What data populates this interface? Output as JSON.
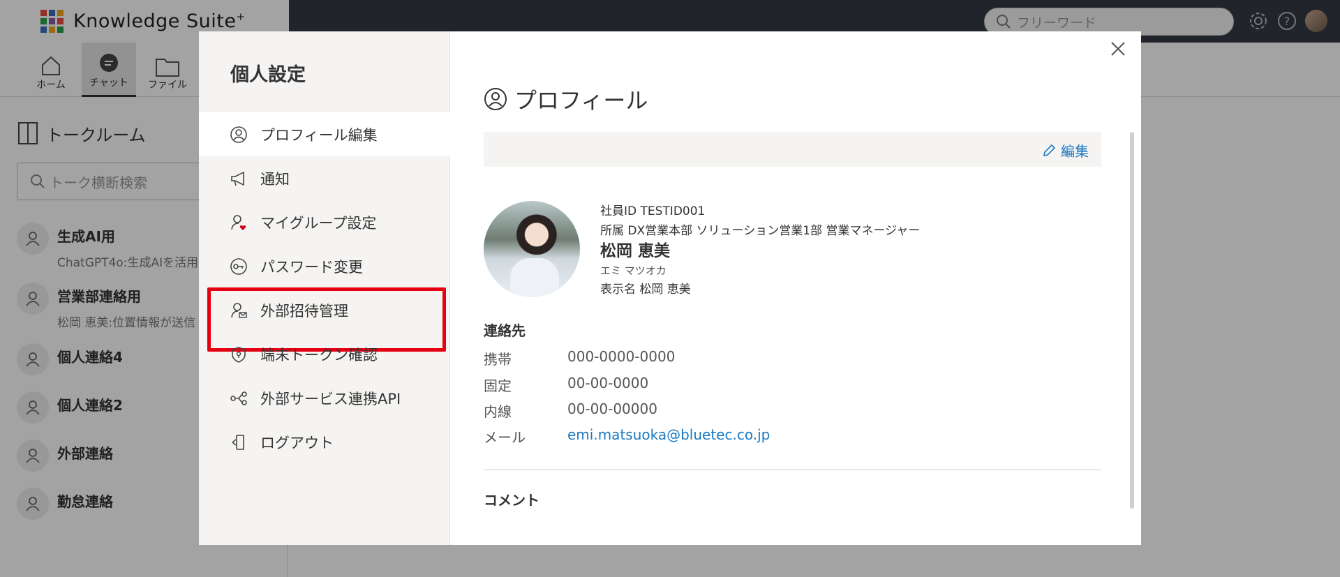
{
  "app": {
    "logo_text": "Knowledge Suite",
    "logo_sup": "+",
    "search_placeholder": "フリーワード"
  },
  "nav": [
    {
      "label": "ホーム",
      "icon": "home-icon"
    },
    {
      "label": "チャット",
      "icon": "chat-icon",
      "active": true
    },
    {
      "label": "ファイル",
      "icon": "folder-icon"
    }
  ],
  "talkroom": {
    "header": "トークルーム",
    "search_placeholder": "トーク横断検索",
    "rooms": [
      {
        "name": "生成AI用",
        "sub": "ChatGPT4o:生成AIを活用"
      },
      {
        "name": "営業部連絡用",
        "sub": "松岡 恵美:位置情報が送信"
      },
      {
        "name": "個人連絡4",
        "sub": ""
      },
      {
        "name": "個人連絡2",
        "sub": ""
      },
      {
        "name": "外部連絡",
        "sub": ""
      },
      {
        "name": "勤怠連絡",
        "sub": ""
      }
    ]
  },
  "modal": {
    "title": "個人設定",
    "menu": [
      {
        "label": "プロフィール編集",
        "icon": "user-circle-icon",
        "active": true
      },
      {
        "label": "通知",
        "icon": "megaphone-icon"
      },
      {
        "label": "マイグループ設定",
        "icon": "user-heart-icon"
      },
      {
        "label": "パスワード変更",
        "icon": "key-icon"
      },
      {
        "label": "外部招待管理",
        "icon": "user-mail-icon",
        "highlight": true
      },
      {
        "label": "端末トークン確認",
        "icon": "shield-icon"
      },
      {
        "label": "外部サービス連携API",
        "icon": "api-link-icon"
      },
      {
        "label": "ログアウト",
        "icon": "logout-icon"
      }
    ]
  },
  "profile": {
    "section_title": "プロフィール",
    "edit_label": "編集",
    "employee_id": "社員ID TESTID001",
    "affiliation": "所属 DX営業本部 ソリューション営業1部 営業マネージャー",
    "name": "松岡 恵美",
    "kana": "エミ マツオカ",
    "display_name": "表示名 松岡 恵美",
    "contact_title": "連絡先",
    "contacts": [
      {
        "key": "携帯",
        "value": "000-0000-0000"
      },
      {
        "key": "固定",
        "value": "00-00-0000"
      },
      {
        "key": "内線",
        "value": "00-00-00000"
      },
      {
        "key": "メール",
        "value": "emi.matsuoka@bluetec.co.jp"
      }
    ],
    "comment_title": "コメント"
  },
  "colors": {
    "link": "#1a78c2",
    "highlight_border": "#e60012",
    "topbar": "#353b44"
  }
}
